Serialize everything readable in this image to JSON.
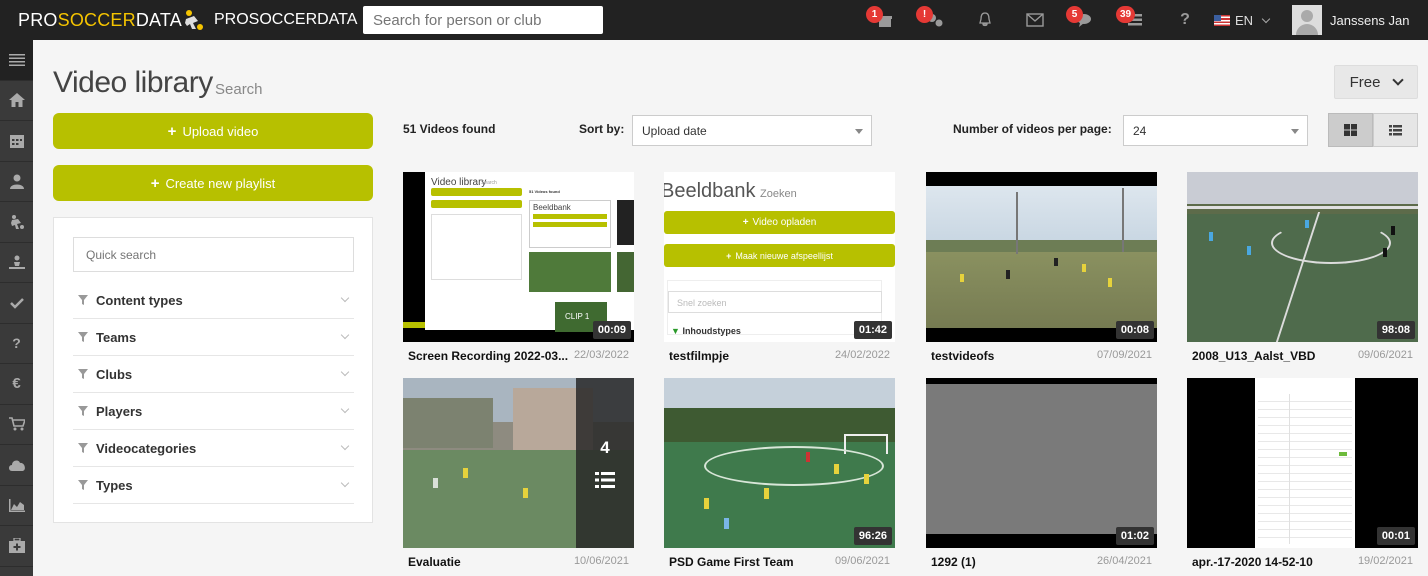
{
  "topbar": {
    "brand_pro": "PRO",
    "brand_soccer": "SOCCER",
    "brand_data": "DATA",
    "club_name": "PROSOCCERDATA",
    "search_placeholder": "Search for person or club",
    "icons": [
      {
        "name": "gift-icon",
        "badge": "1"
      },
      {
        "name": "gears-icon",
        "badge": "!"
      },
      {
        "name": "bell-icon",
        "badge": ""
      },
      {
        "name": "envelope-icon",
        "badge": ""
      },
      {
        "name": "chat-icon",
        "badge": "5"
      },
      {
        "name": "list-icon",
        "badge": "39"
      },
      {
        "name": "help-icon",
        "badge": ""
      }
    ],
    "language": "EN",
    "user_name": "Janssens Jan"
  },
  "sidebar": {
    "icons": [
      "menu-icon",
      "home-icon",
      "calendar-icon",
      "person-icon",
      "soccer-icon",
      "player-icon",
      "check-icon",
      "question-icon",
      "euro-icon",
      "cart-icon",
      "cloud-icon",
      "chart-icon",
      "medkit-icon"
    ]
  },
  "page": {
    "title": "Video library",
    "subtitle": "Search",
    "plan_label": "Free"
  },
  "actions": {
    "upload_label": "Upload video",
    "playlist_label": "Create new playlist"
  },
  "filters": {
    "quick_search_placeholder": "Quick search",
    "facets": [
      "Content types",
      "Teams",
      "Clubs",
      "Players",
      "Videocategories",
      "Types"
    ]
  },
  "toolbar": {
    "count_text": "51 Videos found",
    "sort_label": "Sort by:",
    "sort_value": "Upload date",
    "per_page_label": "Number of videos per page:",
    "per_page_value": "24"
  },
  "videos": [
    {
      "title": "Screen Recording 2022-03...",
      "date": "22/03/2022",
      "duration": "00:09"
    },
    {
      "title": "testfilmpje",
      "date": "24/02/2022",
      "duration": "01:42"
    },
    {
      "title": "testvideofs",
      "date": "07/09/2021",
      "duration": "00:08"
    },
    {
      "title": "2008_U13_Aalst_VBD",
      "date": "09/06/2021",
      "duration": "98:08"
    },
    {
      "title": "Evaluatie",
      "date": "10/06/2021",
      "duration": "",
      "playlist_count": "4"
    },
    {
      "title": "PSD Game First Team",
      "date": "09/06/2021",
      "duration": "96:26"
    },
    {
      "title": "1292 (1)",
      "date": "26/04/2021",
      "duration": "01:02"
    },
    {
      "title": "apr.-17-2020 14-52-10",
      "date": "19/02/2021",
      "duration": "00:01"
    }
  ],
  "thumb_text": {
    "mini_title": "Video library",
    "mini_sub": "Search",
    "mini_count": "51 Videos found",
    "clip_label": "CLIP 1",
    "beeldbank": "Beeldbank",
    "zoeken": "Zoeken",
    "video_opladen": "Video opladen",
    "afspeellijst": "Maak nieuwe afspeellijst",
    "snel_zoeken": "Snel zoeken",
    "inhoudstypes": "Inhoudstypes"
  },
  "colors": {
    "accent": "#b7c000",
    "topbar": "#222222",
    "rail": "#3a3a3a",
    "badge": "#e53935"
  }
}
